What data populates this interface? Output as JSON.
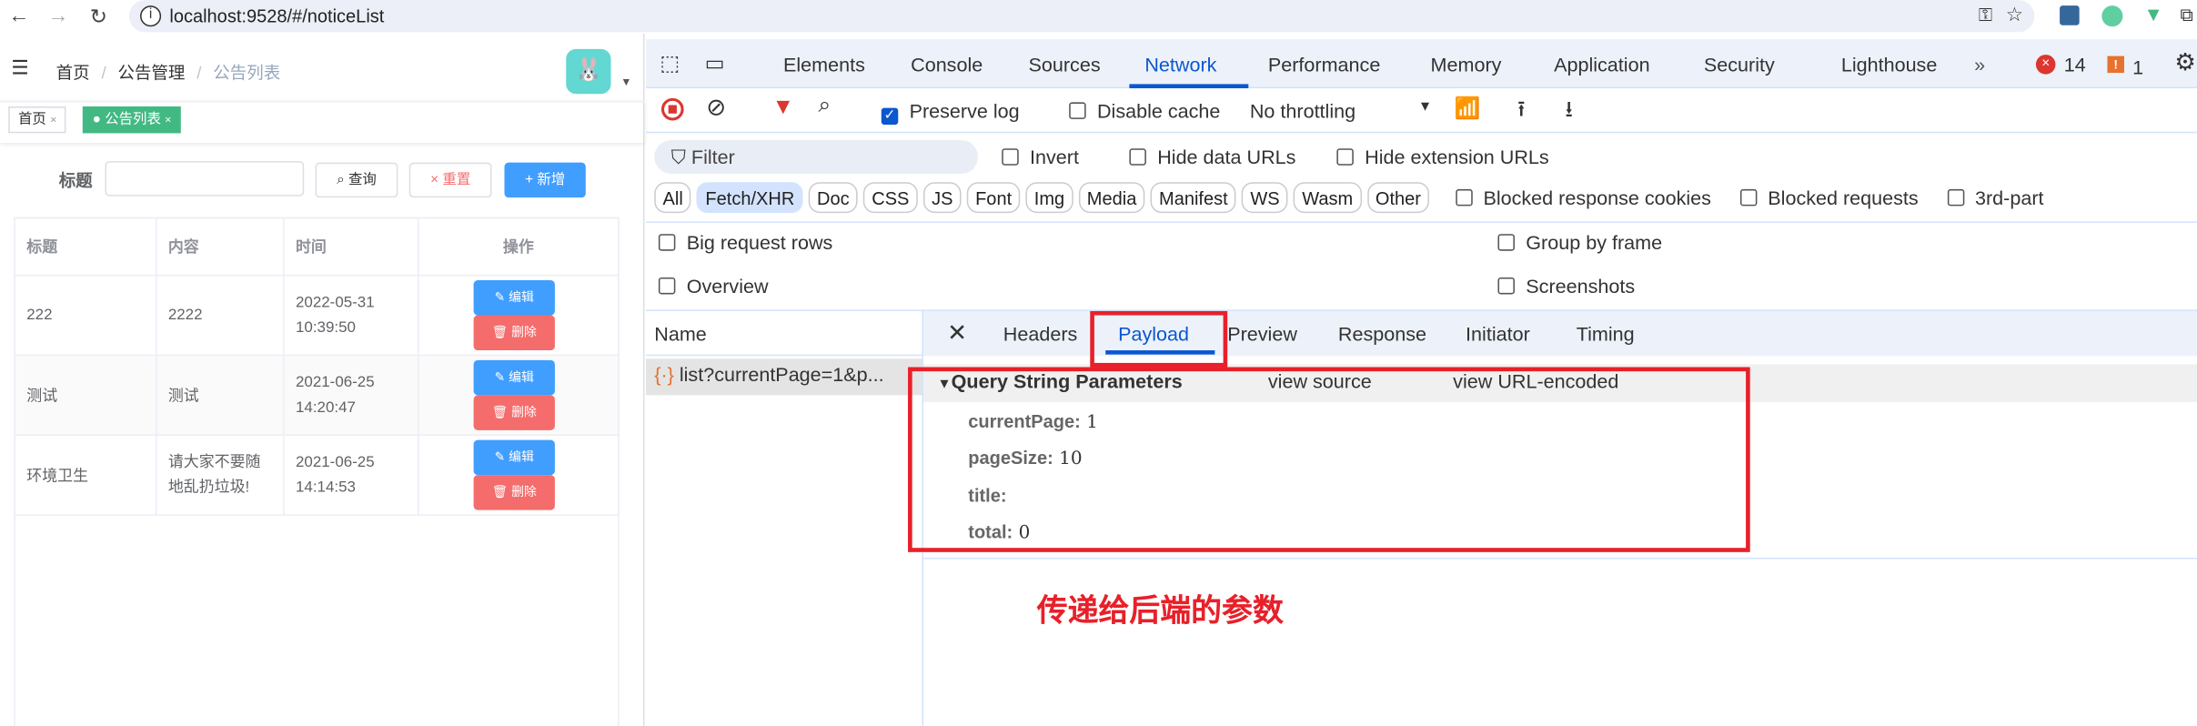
{
  "browser": {
    "url": "localhost:9528/#/noticeList"
  },
  "app": {
    "breadcrumb": [
      "首页",
      "公告管理",
      "公告列表"
    ],
    "tags": [
      {
        "label": "首页"
      },
      {
        "label": "公告列表"
      }
    ],
    "search": {
      "label": "标题",
      "value": "",
      "query": "查询",
      "reset": "重置",
      "add": "新增"
    },
    "table": {
      "headers": [
        "标题",
        "内容",
        "时间",
        "操作"
      ],
      "rows": [
        [
          "222",
          "2222",
          "2022-05-31 10:39:50"
        ],
        [
          "测试",
          "测试",
          "2021-06-25 14:20:47"
        ],
        [
          "环境卫生",
          "请大家不要随地乱扔垃圾!",
          "2021-06-25 14:14:53"
        ]
      ],
      "edit": "编辑",
      "delete": "删除"
    }
  },
  "devtools": {
    "tabs": [
      "Elements",
      "Console",
      "Sources",
      "Network",
      "Performance",
      "Memory",
      "Application",
      "Security",
      "Lighthouse"
    ],
    "active_tab": "Network",
    "errors": "14",
    "warnings": "1",
    "toolbar": {
      "preserve_log": "Preserve log",
      "disable_cache": "Disable cache",
      "throttling": "No throttling"
    },
    "filter": {
      "placeholder": "Filter",
      "invert": "Invert",
      "hide_data": "Hide data URLs",
      "hide_ext": "Hide extension URLs"
    },
    "types": [
      "All",
      "Fetch/XHR",
      "Doc",
      "CSS",
      "JS",
      "Font",
      "Img",
      "Media",
      "Manifest",
      "WS",
      "Wasm",
      "Other"
    ],
    "type_opts": [
      "Blocked response cookies",
      "Blocked requests",
      "3rd-part"
    ],
    "opts": [
      "Big request rows",
      "Group by frame",
      "Overview",
      "Screenshots"
    ],
    "name_header": "Name",
    "request": "list?currentPage=1&p...",
    "detail_tabs": [
      "Headers",
      "Payload",
      "Preview",
      "Response",
      "Initiator",
      "Timing"
    ],
    "qs": {
      "title": "Query String Parameters",
      "view_source": "view source",
      "view_url": "view URL-encoded",
      "params": [
        {
          "k": "currentPage:",
          "v": "1"
        },
        {
          "k": "pageSize:",
          "v": "10"
        },
        {
          "k": "title:",
          "v": ""
        },
        {
          "k": "total:",
          "v": "0"
        }
      ]
    }
  },
  "annotation": "传递给后端的参数",
  "colors": {
    "primary": "#409eff",
    "danger": "#f56c6c",
    "tag_green": "#42b983",
    "highlight": "#e8202a"
  }
}
